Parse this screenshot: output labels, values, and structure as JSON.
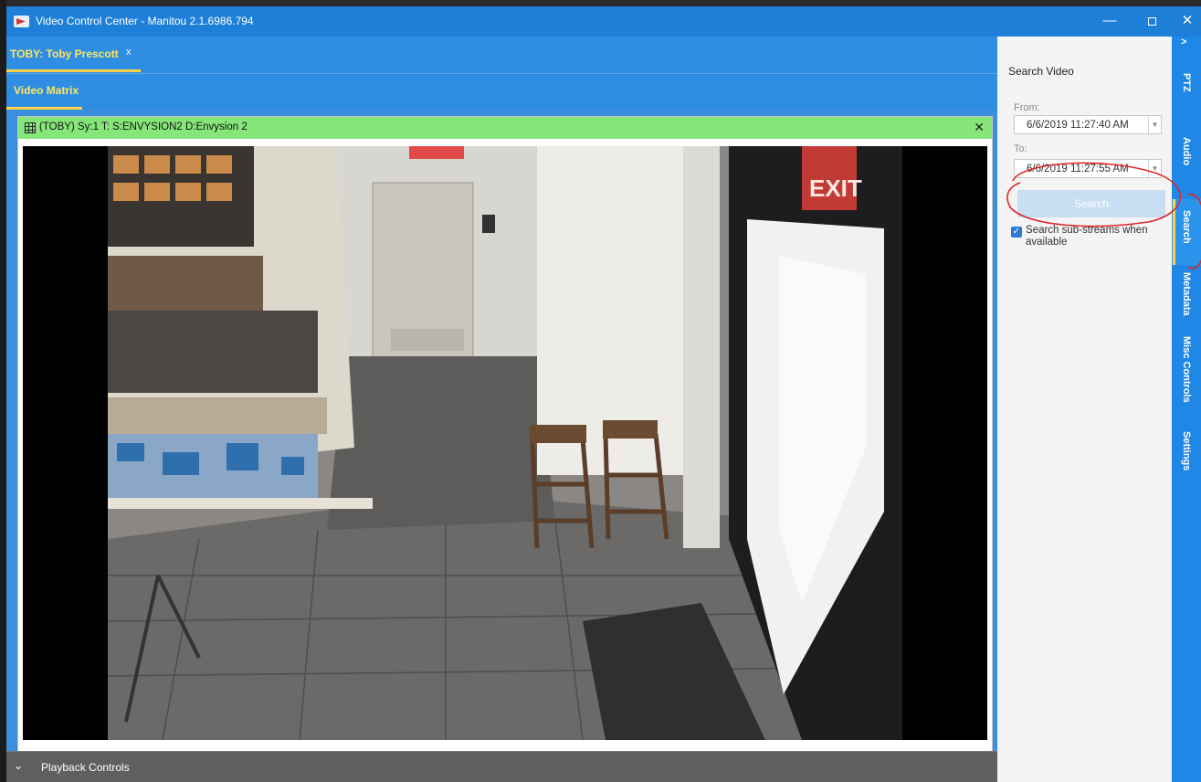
{
  "window": {
    "title": "Video Control Center - Manitou 2.1.6986.794",
    "minimize": "—",
    "close": "✕"
  },
  "tabs": {
    "primary": {
      "label": "TOBY: Toby Prescott",
      "close": "x"
    },
    "secondary": {
      "label": "Video Matrix"
    }
  },
  "video_panel": {
    "title": "(TOBY)  Sy:1 T:  S:ENVYSION2 D:Envysion 2",
    "close": "✕",
    "sign_text": "EXIT"
  },
  "playback": {
    "chevron": "⌄",
    "label": "Playback Controls"
  },
  "search_panel": {
    "title": "Search Video",
    "from_label": "From:",
    "from_value": "6/6/2019 11:27:40 AM",
    "to_label": "To:",
    "to_value": "6/6/2019 11:27:55 AM",
    "dropdown_glyph": "▼",
    "search_button": "Search",
    "checkbox_label": "Search sub-streams when available",
    "checkbox_checked": true,
    "check_glyph": "✓"
  },
  "side_tabs": {
    "collapse": ">",
    "items": [
      "PTZ",
      "Audio",
      "Search",
      "Metadata",
      "Misc Controls",
      "Settings"
    ],
    "active": "Search"
  },
  "colors": {
    "title_bar": "#1e7fd8",
    "tab_text": "#ffe562",
    "panel_header": "#86e67a",
    "side_tabs": "#1f87e5",
    "annotation": "#e0262a"
  }
}
